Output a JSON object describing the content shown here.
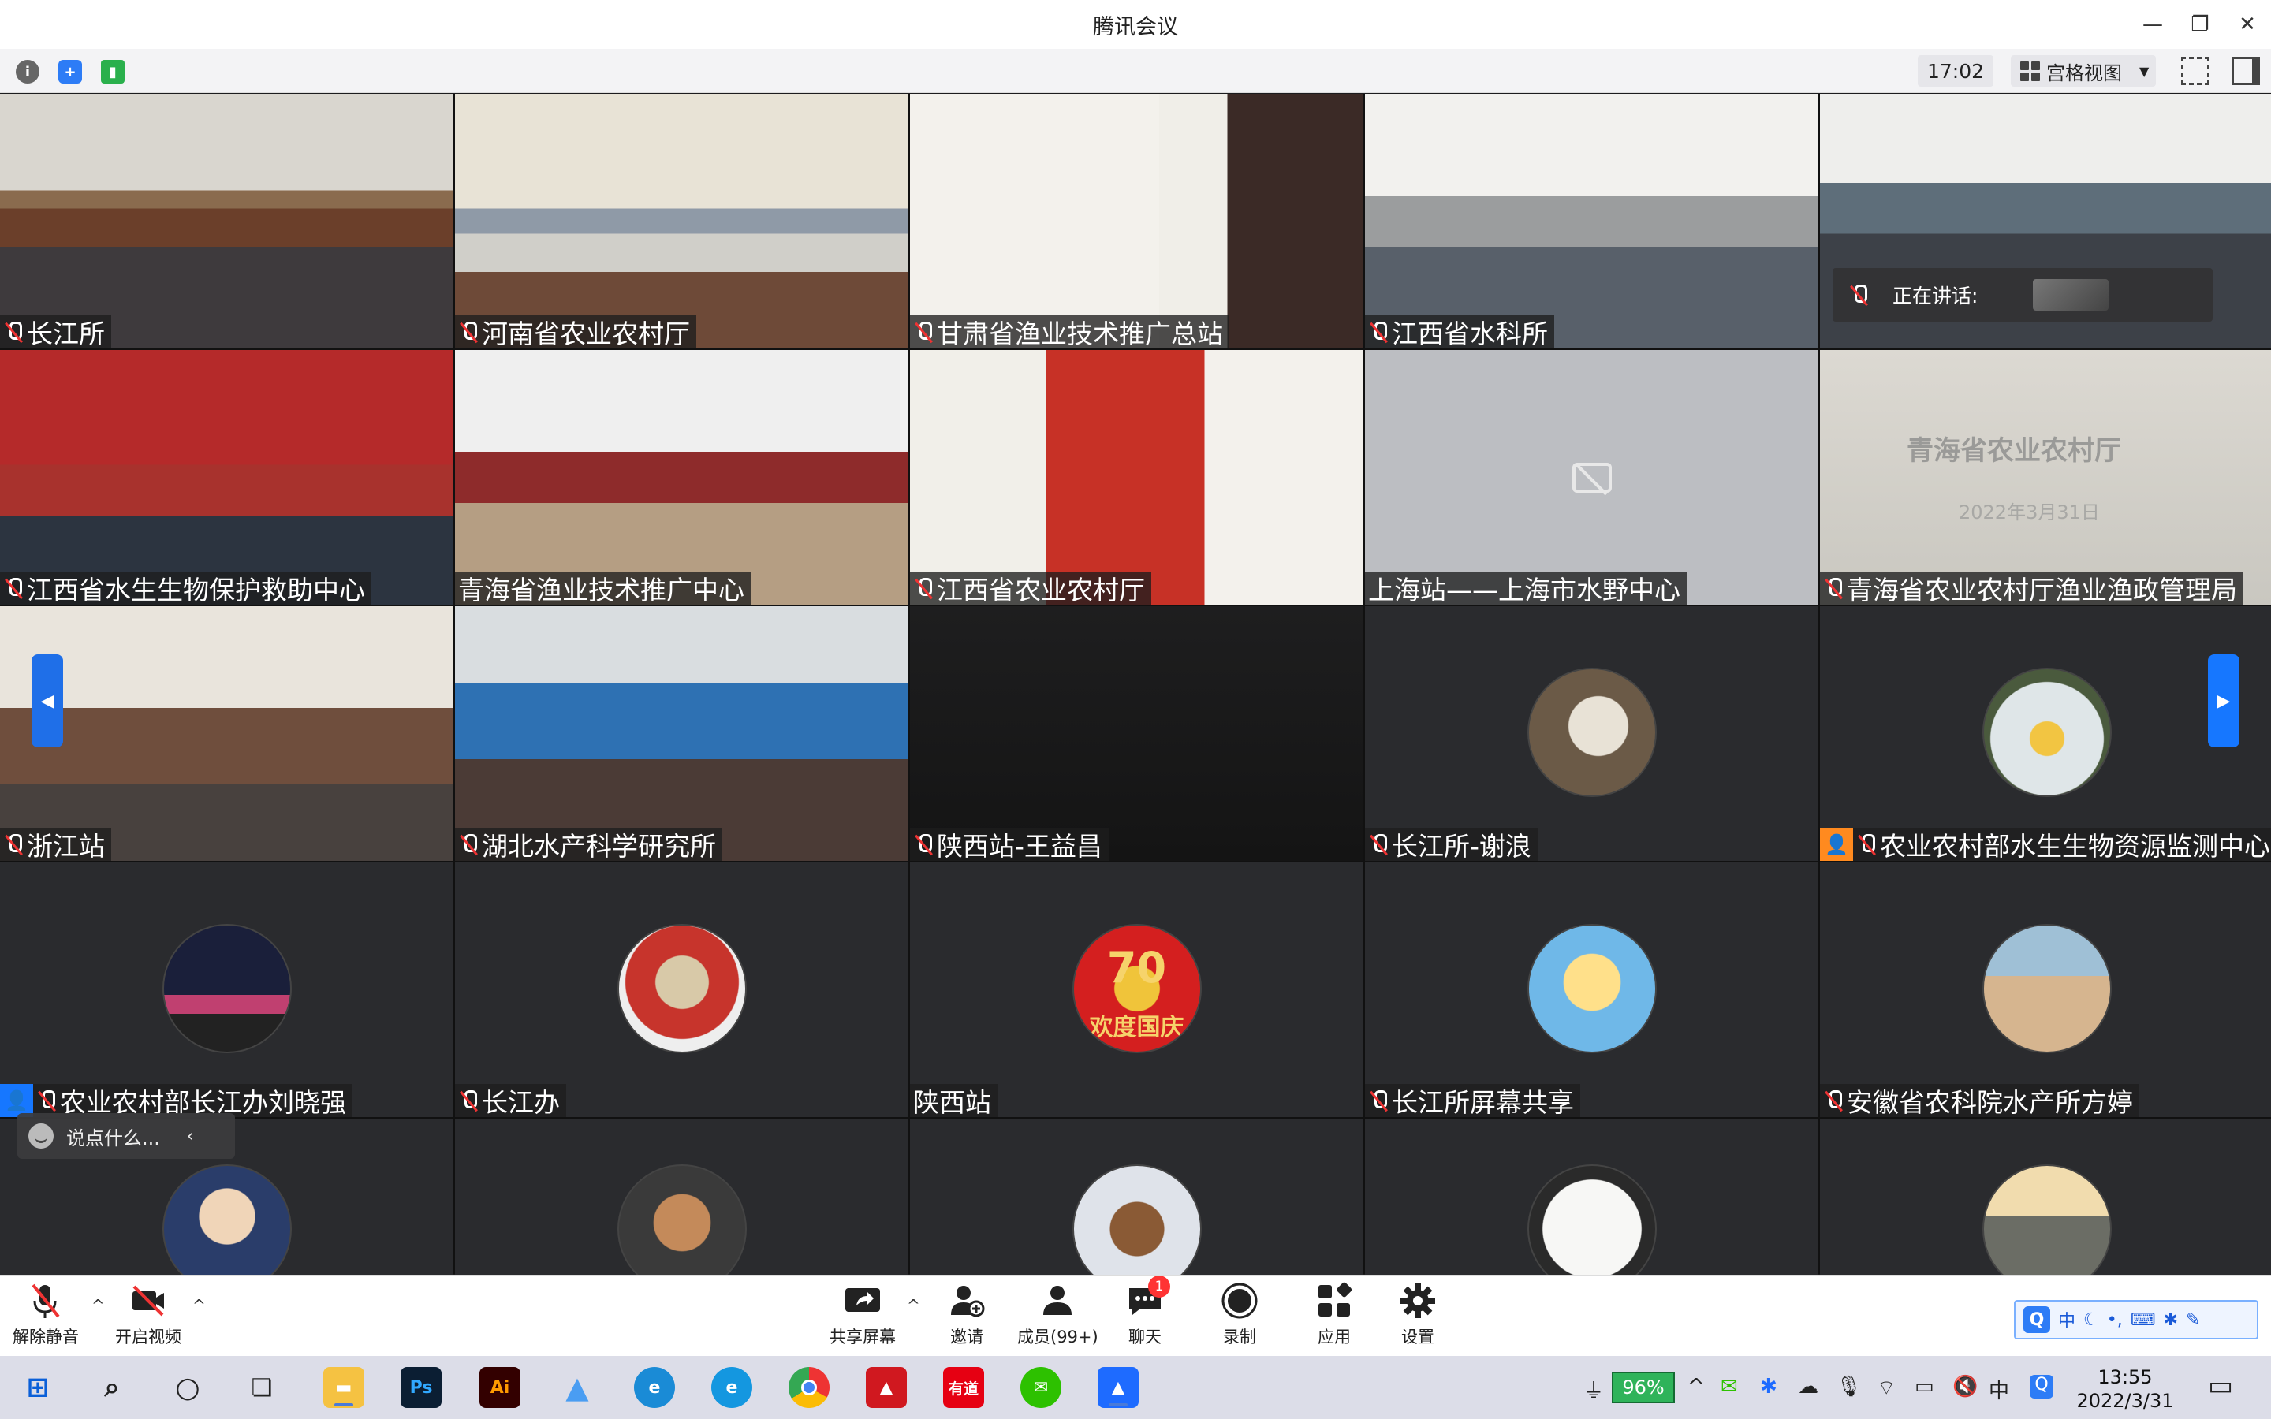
{
  "window": {
    "title": "腾讯会议"
  },
  "topbar": {
    "time": "17:02",
    "view_label": "宫格视图"
  },
  "speaking": {
    "label": "正在讲话:"
  },
  "tiles": [
    {
      "name": "长江所",
      "kind": "video",
      "mic": true
    },
    {
      "name": "河南省农业农村厅",
      "kind": "video",
      "mic": true
    },
    {
      "name": "甘肃省渔业技术推广总站",
      "kind": "video",
      "mic": true
    },
    {
      "name": "江西省水科所",
      "kind": "video",
      "mic": true
    },
    {
      "name": "",
      "kind": "video",
      "mic": true
    },
    {
      "name": "江西省水生生物保护救助中心",
      "kind": "video",
      "mic": true
    },
    {
      "name": "青海省渔业技术推广中心",
      "kind": "video",
      "mic": false
    },
    {
      "name": "江西省农业农村厅",
      "kind": "video",
      "mic": true
    },
    {
      "name": "上海站——上海市水野中心",
      "kind": "camoff",
      "mic": false
    },
    {
      "name": "青海省农业农村厅渔业渔政管理局",
      "kind": "video",
      "mic": true
    },
    {
      "name": "浙江站",
      "kind": "video",
      "mic": true
    },
    {
      "name": "湖北水产科学研究所",
      "kind": "video",
      "mic": true
    },
    {
      "name": "陕西站-王益昌",
      "kind": "dark",
      "mic": true
    },
    {
      "name": "长江所-谢浪",
      "kind": "avatar",
      "mic": true
    },
    {
      "name": "农业农村部水生生物资源监测中心",
      "kind": "avatar",
      "mic": true,
      "badge": "orange"
    },
    {
      "name": "农业农村部长江办刘晓强",
      "kind": "avatar",
      "mic": true,
      "badge": "blue"
    },
    {
      "name": "长江办",
      "kind": "avatar",
      "mic": true
    },
    {
      "name": "陕西站",
      "kind": "avatar",
      "mic": false
    },
    {
      "name": "长江所屏幕共享",
      "kind": "avatar",
      "mic": true
    },
    {
      "name": "安徽省农科院水产所方婷",
      "kind": "avatar",
      "mic": true
    },
    {
      "name": "",
      "kind": "avatar",
      "mic": false
    },
    {
      "name": "",
      "kind": "avatar",
      "mic": false
    },
    {
      "name": "",
      "kind": "avatar",
      "mic": false
    },
    {
      "name": "",
      "kind": "avatar",
      "mic": false
    },
    {
      "name": "",
      "kind": "avatar",
      "mic": false
    }
  ],
  "scene_text": {
    "qinghai_slide_title": "青海省农业农村厅",
    "qinghai_slide_date": "2022年3月31日",
    "national_day": "欢度国庆",
    "seventy": "70"
  },
  "chat": {
    "placeholder": "说点什么..."
  },
  "controls": {
    "unmute": "解除静音",
    "start_video": "开启视频",
    "share_screen": "共享屏幕",
    "invite": "邀请",
    "members": "成员(99+)",
    "chat": "聊天",
    "chat_badge": "1",
    "record": "录制",
    "apps": "应用",
    "settings": "设置"
  },
  "ime": {
    "q": "Q",
    "mode": "中"
  },
  "taskbar": {
    "battery": "96%",
    "time": "13:55",
    "date": "2022/3/31",
    "lang": "中",
    "apps": [
      "Ps",
      "Ai",
      "有道"
    ]
  }
}
